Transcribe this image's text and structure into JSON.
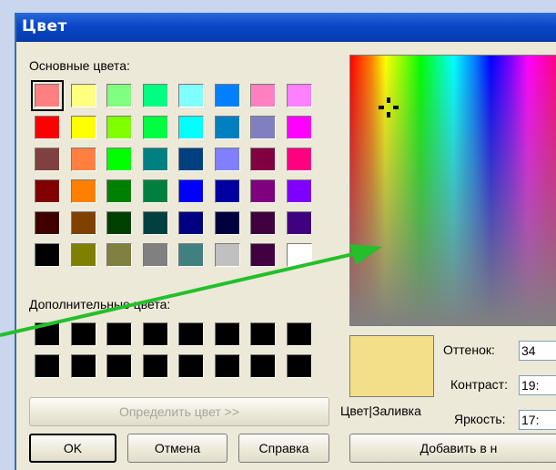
{
  "window": {
    "title": "Цвет"
  },
  "basic_colors": {
    "label": "Основные цвета:",
    "selected_index": 0,
    "rows": [
      [
        "#ff8080",
        "#ffff80",
        "#80ff80",
        "#00ff80",
        "#80ffff",
        "#0080ff",
        "#ff80c0",
        "#ff80ff"
      ],
      [
        "#ff0000",
        "#ffff00",
        "#80ff00",
        "#00ff40",
        "#00ffff",
        "#0080c0",
        "#8080c0",
        "#ff00ff"
      ],
      [
        "#804040",
        "#ff8040",
        "#00ff00",
        "#008080",
        "#004080",
        "#8080ff",
        "#800040",
        "#ff0080"
      ],
      [
        "#800000",
        "#ff8000",
        "#008000",
        "#008040",
        "#0000ff",
        "#0000a0",
        "#800080",
        "#8000ff"
      ],
      [
        "#400000",
        "#804000",
        "#004000",
        "#004040",
        "#000080",
        "#000040",
        "#400040",
        "#400080"
      ],
      [
        "#000000",
        "#808000",
        "#808040",
        "#808080",
        "#408080",
        "#c0c0c0",
        "#400040",
        "#ffffff"
      ]
    ]
  },
  "custom_colors": {
    "label": "Дополнительные цвета:",
    "rows": [
      [
        "#000000",
        "#000000",
        "#000000",
        "#000000",
        "#000000",
        "#000000",
        "#000000",
        "#000000"
      ],
      [
        "#000000",
        "#000000",
        "#000000",
        "#000000",
        "#000000",
        "#000000",
        "#000000",
        "#000000"
      ]
    ]
  },
  "buttons": {
    "define": "Определить цвет >>",
    "ok": "OK",
    "cancel": "Отмена",
    "help": "Справка",
    "add": "Добавить в н"
  },
  "preview": {
    "label": "Цвет|Заливка",
    "color": "#f3df8a"
  },
  "fields": {
    "hue_label": "Оттенок:",
    "hue_value": "34",
    "sat_label": "Контраст:",
    "sat_value": "19:",
    "lum_label": "Яркость:",
    "lum_value": "17:"
  },
  "annotation": {
    "arrow_color": "#22c02a"
  }
}
